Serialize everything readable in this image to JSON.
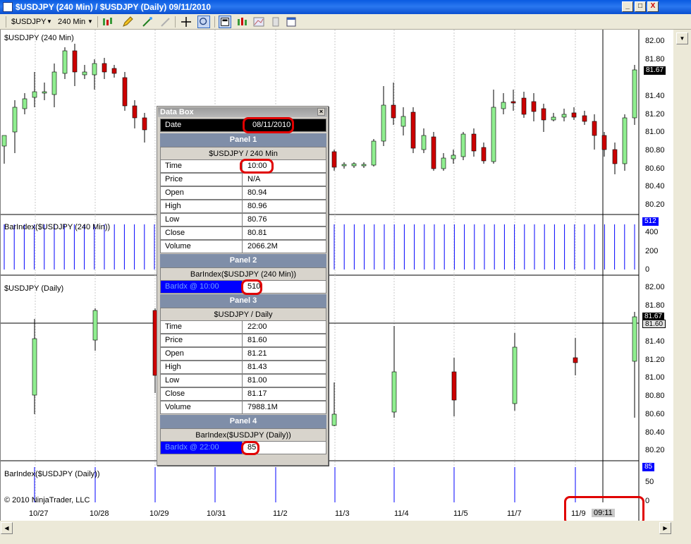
{
  "window": {
    "title": "$USDJPY (240 Min) / $USDJPY (Daily)  09/11/2010",
    "buttons": [
      "_",
      "□",
      "X"
    ]
  },
  "toolbar": {
    "instrument": "$USDJPY",
    "interval": "240 Min"
  },
  "panels": {
    "p1": {
      "title": "$USDJPY (240 Min)",
      "last_price": "81.67",
      "price_axis": [
        "82.00",
        "81.80",
        "81.60",
        "81.40",
        "81.20",
        "81.00",
        "80.80",
        "80.60",
        "80.40",
        "80.20"
      ]
    },
    "p2": {
      "title": "BarIndex($USDJPY (240 Min))",
      "last_value": "512",
      "axis": [
        "400",
        "200",
        "0"
      ]
    },
    "p3": {
      "title": "$USDJPY (Daily)",
      "last_price": "81.67",
      "crosshair_price": "81.60",
      "price_axis": [
        "82.00",
        "81.80",
        "81.40",
        "81.20",
        "81.00",
        "80.80",
        "80.60",
        "80.40",
        "80.20"
      ]
    },
    "p4": {
      "title": "BarIndex($USDJPY (Daily))",
      "last_value": "85",
      "axis": [
        "50",
        "0"
      ]
    }
  },
  "date_axis": [
    "10/27",
    "10/28",
    "10/29",
    "10/31",
    "11/2",
    "11/3",
    "11/4",
    "11/5",
    "11/7",
    "11/9"
  ],
  "cursor_time": "09:11",
  "copyright": "© 2010 NinjaTrader, LLC",
  "databox": {
    "title": "Data Box",
    "date_label": "Date",
    "date_value": "08/11/2010",
    "panel1": {
      "header": "Panel 1",
      "sub": "$USDJPY / 240 Min",
      "rows": [
        {
          "k": "Time",
          "v": "10:00"
        },
        {
          "k": "Price",
          "v": "N/A"
        },
        {
          "k": "Open",
          "v": "80.94"
        },
        {
          "k": "High",
          "v": "80.96"
        },
        {
          "k": "Low",
          "v": "80.76"
        },
        {
          "k": "Close",
          "v": "80.81"
        },
        {
          "k": "Volume",
          "v": "2066.2M"
        }
      ]
    },
    "panel2": {
      "header": "Panel 2",
      "sub": "BarIndex($USDJPY (240 Min))",
      "row": {
        "k": "BarIdx @ 10:00",
        "v": "510"
      }
    },
    "panel3": {
      "header": "Panel 3",
      "sub": "$USDJPY / Daily",
      "rows": [
        {
          "k": "Time",
          "v": "22:00"
        },
        {
          "k": "Price",
          "v": "81.60"
        },
        {
          "k": "Open",
          "v": "81.21"
        },
        {
          "k": "High",
          "v": "81.43"
        },
        {
          "k": "Low",
          "v": "81.00"
        },
        {
          "k": "Close",
          "v": "81.17"
        },
        {
          "k": "Volume",
          "v": "7988.1M"
        }
      ]
    },
    "panel4": {
      "header": "Panel 4",
      "sub": "BarIndex($USDJPY (Daily))",
      "row": {
        "k": "BarIdx @ 22:00",
        "v": "85"
      }
    }
  },
  "colors": {
    "up": "#90ee90",
    "down": "#cc0000",
    "barindex": "#0000ff",
    "databox_header": "#7f8ea8"
  }
}
